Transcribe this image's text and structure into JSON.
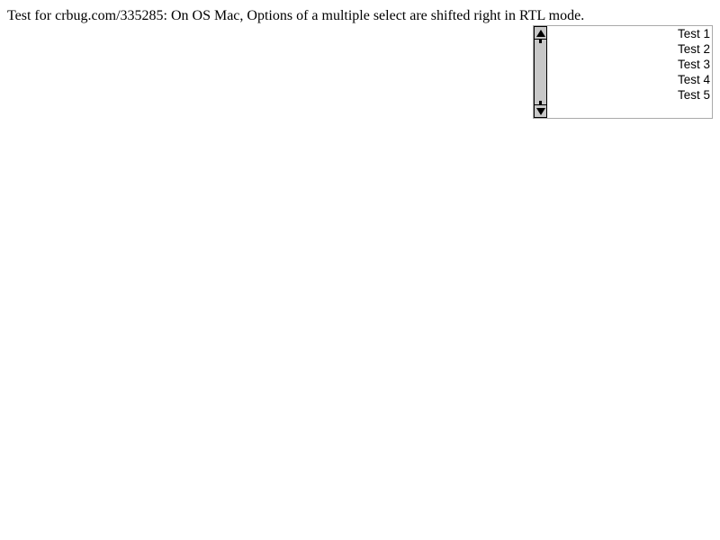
{
  "page": {
    "title": "Test for crbug.com/335285: On OS Mac, Options of a multiple select are shifted right in RTL mode."
  },
  "select": {
    "multiple": true,
    "direction": "rtl",
    "options": [
      "Test 1",
      "Test 2",
      "Test 3",
      "Test 4",
      "Test 5"
    ]
  }
}
